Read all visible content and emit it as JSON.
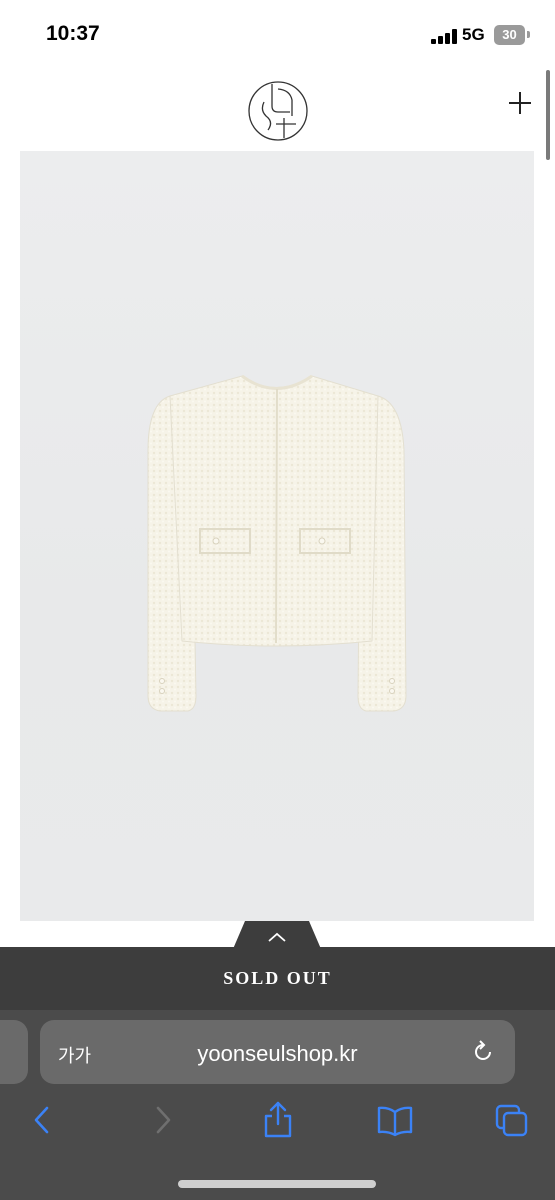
{
  "status_bar": {
    "time": "10:37",
    "network": "5G",
    "battery": "30"
  },
  "header": {
    "logo_icon": "circle-monogram-logo",
    "menu_icon": "plus-icon"
  },
  "product": {
    "image_subject": "cream boucle cropped jacket",
    "sold_out_label": "SOLD OUT"
  },
  "browser": {
    "text_size_label": "가가",
    "url": "yoonseulshop.kr",
    "icons": [
      "back-icon",
      "forward-icon",
      "share-icon",
      "bookmarks-icon",
      "tabs-icon",
      "reload-icon"
    ]
  },
  "colors": {
    "sold_out_bg": "#3d3d3d",
    "safari_bg": "#4b4b4b",
    "address_bar_bg": "#6a6a6a",
    "accent_blue": "#3b82f6"
  }
}
